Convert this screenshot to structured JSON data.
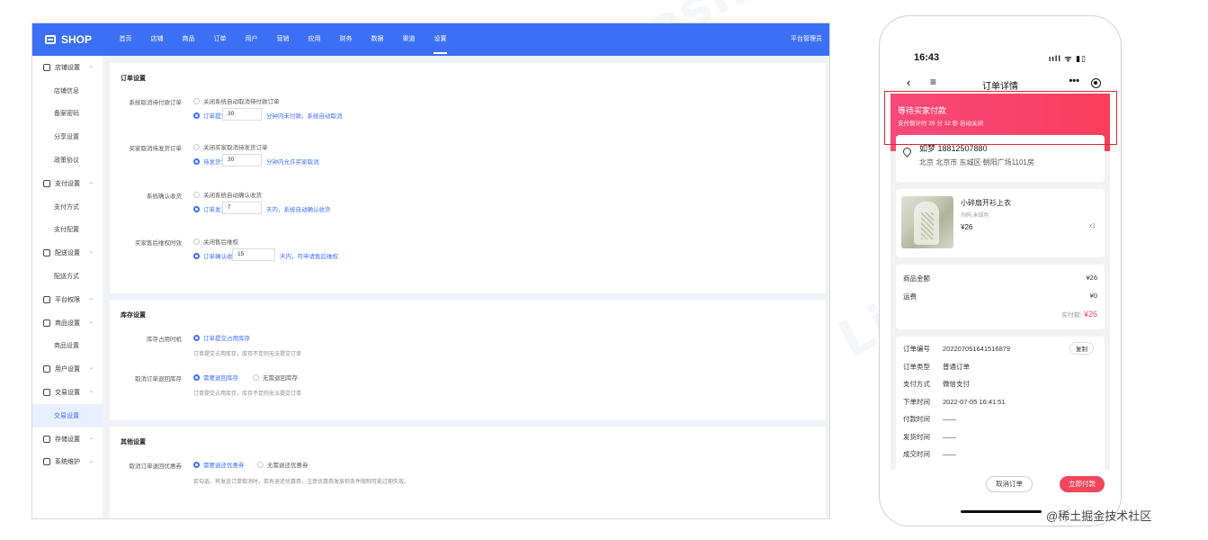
{
  "admin": {
    "logo_text": "SHOP",
    "nav": [
      "首页",
      "店铺",
      "商品",
      "订单",
      "用户",
      "营销",
      "应用",
      "财务",
      "数据",
      "渠道",
      "设置"
    ],
    "nav_active_index": 10,
    "user_label": "平台管理员",
    "sidebar": [
      {
        "type": "group",
        "label": "店铺设置",
        "icon": "store-icon"
      },
      {
        "type": "sub",
        "label": "店铺信息"
      },
      {
        "type": "sub",
        "label": "备案密码"
      },
      {
        "type": "sub",
        "label": "分享设置"
      },
      {
        "type": "sub",
        "label": "政策协议"
      },
      {
        "type": "group",
        "label": "支付设置",
        "icon": "payment-icon"
      },
      {
        "type": "sub",
        "label": "支付方式"
      },
      {
        "type": "sub",
        "label": "支付配置"
      },
      {
        "type": "group",
        "label": "配送设置",
        "icon": "truck-icon"
      },
      {
        "type": "sub",
        "label": "配送方式"
      },
      {
        "type": "group",
        "label": "平台权限",
        "icon": "home-icon"
      },
      {
        "type": "group",
        "label": "商品设置",
        "icon": "bag-icon"
      },
      {
        "type": "sub",
        "label": "商品设置"
      },
      {
        "type": "group",
        "label": "用户设置",
        "icon": "user-icon"
      },
      {
        "type": "group",
        "label": "交易设置",
        "icon": "trade-icon"
      },
      {
        "type": "sub",
        "label": "交易设置",
        "active": true
      },
      {
        "type": "group",
        "label": "存储设置",
        "icon": "storage-icon"
      },
      {
        "type": "group",
        "label": "系统维护",
        "icon": "system-icon"
      }
    ],
    "order_settings": {
      "title": "订单设置",
      "rows": [
        {
          "label": "系统取消待付款订单",
          "off_option": "关闭系统自动取消待付款订单",
          "on_option": "订单提交后",
          "value": "30",
          "suffix": "分钟内未付款，系统自动取消"
        },
        {
          "label": "买家取消待发货订单",
          "off_option": "关闭买家取消待发货订单",
          "on_option": "待发货订单",
          "value": "30",
          "suffix": "分钟内允许买家取消"
        },
        {
          "label": "系统确认收货",
          "off_option": "关闭系统自动确认收货",
          "on_option": "订单发货后",
          "value": "7",
          "suffix": "天内，系统自动确认收货"
        },
        {
          "label": "买家售后维权时效",
          "off_option": "关闭售后维权",
          "on_option": "订单确认收货后",
          "value": "15",
          "suffix": "天内，可申请售后维权"
        }
      ]
    },
    "stock_settings": {
      "title": "库存设置",
      "occupy_label": "库存占用时机",
      "occupy_option": "订单提交占用库存",
      "occupy_hint": "订单提交占用库存，库存不足则无法提交订单",
      "return_label": "取消订单退回库存",
      "return_yes": "需要退回库存",
      "return_no": "无需退回库存",
      "return_hint": "订单提交占用库存，库存不足则无法提交订单"
    },
    "other_settings": {
      "title": "其他设置",
      "coupon_label": "取消订单退回优惠券",
      "coupon_yes": "需要退还优惠券",
      "coupon_no": "无需退还优惠券",
      "coupon_hint": "若勾选，将发送订单取消时，若有退还优惠券，注意优惠券发放但条件限制可能过期失效。"
    }
  },
  "phone": {
    "time": "16:43",
    "status_icons": "ııll ᯤ ▮▯",
    "title": "订单详情",
    "banner_title": "等待买家付款",
    "banner_sub": "支付倒计时 29 分 32 秒 自动关闭",
    "address": {
      "name_phone": "如梦 18812507880",
      "detail": "北京 北京市 东城区 朝阳广场1101房"
    },
    "product": {
      "name": "小碎扇开衫上衣",
      "spec": "均码,米绿色",
      "price": "¥26",
      "qty": "x1"
    },
    "summary": {
      "goods_label": "商品金额",
      "goods_value": "¥26",
      "ship_label": "运费",
      "ship_value": "¥0",
      "paid_label": "实付款:",
      "paid_value": "¥26"
    },
    "info": [
      {
        "k": "订单编号",
        "v": "2022070516415168​79"
      },
      {
        "k": "订单类型",
        "v": "普通订单"
      },
      {
        "k": "支付方式",
        "v": "微信支付"
      },
      {
        "k": "下单时间",
        "v": "2022-07-05 16:41:51"
      },
      {
        "k": "付款时间",
        "v": "——"
      },
      {
        "k": "发货时间",
        "v": "——"
      },
      {
        "k": "成交时间",
        "v": "——"
      }
    ],
    "copy_label": "复制",
    "cancel_label": "取消订单",
    "pay_label": "立即付款"
  },
  "credit": "@稀土掘金技术社区",
  "watermark": "Likeshop"
}
